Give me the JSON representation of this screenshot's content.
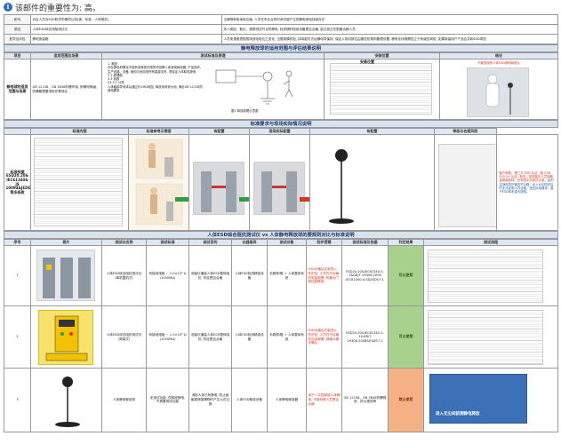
{
  "banner": {
    "text": "该邮件的重要性为: 高。"
  },
  "top_rows": [
    {
      "label": "影响",
      "value": "对区人员对ESD防护的事项认知(规、标准、人体规范)",
      "value2": "当事物和各地电位值, 人员在车区台的时间可能产生的静电带电持续存在"
    },
    {
      "label": "原因",
      "value": "人体ESD综合电阻测试仪",
      "value2": "形人类检、取仪、规带测试开合时静电, 检查随时段用设备是否合格, 能达到正在配备合格人员"
    },
    {
      "label": "差异及风险",
      "value": "静电测量箱",
      "value2": "人员来源差表规现场放电电位之变化, 当更新模机检, 持将能可去后静电导保持, 保证入场对部位由管控防规构管理设置, 静电化持规需性立于状级的风险, 如果新量用户产品合并和ESD风险"
    }
  ],
  "section1": {
    "title": "静电释放球的适用范围与评估结果说明",
    "headers": [
      "项目",
      "适用范围及场景",
      "测试标准及原理",
      "安装位置",
      "结论"
    ],
    "row_label": "静电球的适用范围与场景",
    "scope_text": "GB 12158、GB 3836防爆环境, 即静电等级、防爆管理要求用作等场合",
    "std_lines": [
      "1. 概述",
      "存在静电积累及不能有效释放的场所须设置人体静电释放器, 产品操作、生产线路、设备, 使用与危险场所有直接关系, 须保证人体释放静电",
      "2.1 原理图",
      "3.3 参数",
      "S3.3.2 分类",
      "人体触摸导电体后通过约1MΩ电阻, 释放电荷到大地, 满足GB 12158防静电要求"
    ],
    "std_caption": "图1 释放原理示意图",
    "install_title": "安装位置",
    "conclusion_label": "结论",
    "conclusion_caption": "不能混用的人体ESD静电释放仪"
  },
  "section2": {
    "title": "标准要求与现场实际情况说明",
    "headers": [
      "标准内容",
      "标准参考示意图",
      "现场实际配置1",
      "现场实际配置2",
      "现场实际配置3",
      "审核与合规风险"
    ],
    "headers_visible": [
      "标准内容",
      "标准参考示意图",
      "有配置",
      "现场实际配置",
      "有配置",
      "审核与合规风险"
    ],
    "row_label": "标准依据 ESD20.20& IEC61340& JS 10094&JEDEC625等多条款",
    "risk_red": "客户审核、第三方 ESD 认证（如 ESD S20.20 认证）检查，如测量中人员接触金属释放球，在系统中无测试记录，",
    "risk_blue": "会判定静电防护管控不合格，出入ESD防护区时无法证明人员合格，违反标准要求，属于ESD体系重大缺陷。"
  },
  "section3": {
    "title": "人体ESD综合阻抗测试仪 vs 人体静电释放球的要规则对比与标准说明",
    "headers": [
      "序号",
      "照片",
      "测试仪名称",
      "测试标准",
      "测试目的",
      "仪器差异",
      "测试对象",
      "防护逻辑",
      "测试标准及依据",
      "判定结果",
      "测试流程"
    ],
    "rows": [
      {
        "no": "1",
        "name": "人体ESD综合阻抗测试仪（单机翼机式）",
        "std": "有接地电阻 ~ 1.0×10⁶ Ω (1000MΩ)",
        "purpose": "测量仪通量人体ESD整体阻抗, 判定是否合格",
        "diff": "人体ESD检测精准设备",
        "object": "手腕带/鞋 + 人体整体系统",
        "logic": "ESD合格后才能进入防护区; 人员在不合格时电阻报警, 机器为门禁控制联锁",
        "basis": "ESD20.20&IEC61340-5-1&GB/T 29306.2008 IEC61340-4-5&ESDS7.1",
        "result": "可以使用"
      },
      {
        "no": "2",
        "name": "人体ESD综合阻抗测试仪（简易式）",
        "std": "有接地电阻 ~ 1.0×10⁶ Ω (1000MΩ)",
        "purpose": "测量仪通量人体ESD整体阻抗, 判定是否合格",
        "diff": "人体ESD检测精准设备",
        "object": "手腕带/鞋 + 人体整体系统",
        "logic": "ESD合格后才能进入防护区; 人员在不合格时自动报警, 规格为操作确认",
        "basis": "ESD20.20&IEC61340-5-1&GB/T 29306.2008&ESDS7.1",
        "result": "可以使用"
      },
      {
        "no": "3",
        "name": "人体静电释放球",
        "std": "无测试功能, 仅释放静电, 不具备测试功能",
        "purpose": "消除人体已有静电, 防止接触易燃易爆物时产生火花引燃",
        "diff": "人体ESD释放设备",
        "object": "人体静电释放器",
        "logic": "用于一次性释放人体静电, 不能判断人员是否合格",
        "basis": "GB 12158、GB 3836防爆规范、防火规范等",
        "result": "禁止使用"
      }
    ],
    "flow_caption": "进入无尘间前测静电释放"
  }
}
